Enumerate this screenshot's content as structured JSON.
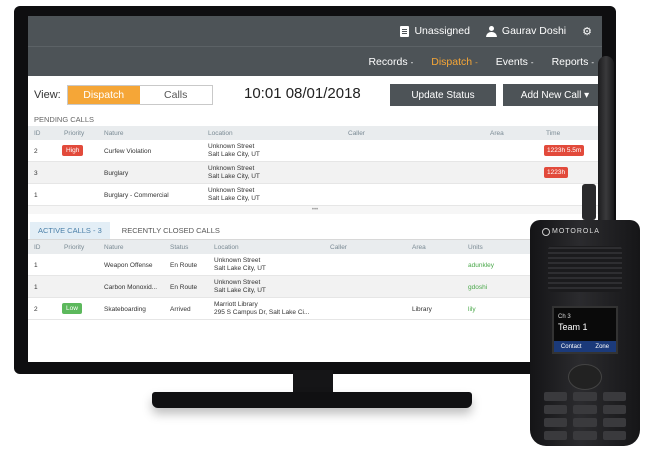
{
  "topbar": {
    "unassigned_label": "Unassigned",
    "user_name": "Gaurav Doshi"
  },
  "nav": [
    {
      "label": "Records",
      "active": false
    },
    {
      "label": "Dispatch",
      "active": true
    },
    {
      "label": "Events",
      "active": false
    },
    {
      "label": "Reports",
      "active": false
    }
  ],
  "controls": {
    "view_label": "View:",
    "toggle_dispatch": "Dispatch",
    "toggle_calls": "Calls",
    "datetime": "10:01 08/01/2018",
    "update_status": "Update Status",
    "add_new_call": "Add New Call"
  },
  "pending": {
    "label": "PENDING CALLS",
    "headers": {
      "id": "ID",
      "priority": "Priority",
      "nature": "Nature",
      "location": "Location",
      "caller": "Caller",
      "area": "Area",
      "time": "Time"
    },
    "rows": [
      {
        "id": "2",
        "priority": "High",
        "nature": "Curfew Violation",
        "loc1": "Unknown Street",
        "loc2": "Salt Lake City, UT",
        "time": "1223h 5.5m"
      },
      {
        "id": "3",
        "priority": "",
        "nature": "Burglary",
        "loc1": "Unknown Street",
        "loc2": "Salt Lake City, UT",
        "time": "1223h"
      },
      {
        "id": "1",
        "priority": "",
        "nature": "Burglary - Commercial",
        "loc1": "Unknown Street",
        "loc2": "Salt Lake City, UT",
        "time": ""
      }
    ]
  },
  "tabs": {
    "active_calls": "ACTIVE CALLS - 3",
    "recently_closed": "RECENTLY CLOSED CALLS"
  },
  "active": {
    "headers": {
      "id": "ID",
      "priority": "Priority",
      "nature": "Nature",
      "status": "Status",
      "location": "Location",
      "caller": "Caller",
      "area": "Area",
      "units": "Units"
    },
    "rows": [
      {
        "id": "1",
        "priority": "",
        "nature": "Weapon Offense",
        "status": "En Route",
        "loc1": "Unknown Street",
        "loc2": "Salt Lake City, UT",
        "area": "",
        "units": "adunkley"
      },
      {
        "id": "1",
        "priority": "",
        "nature": "Carbon Monoxid...",
        "status": "En Route",
        "loc1": "Unknown Street",
        "loc2": "Salt Lake City, UT",
        "area": "",
        "units": "gdoshi"
      },
      {
        "id": "2",
        "priority": "Low",
        "nature": "Skateboarding",
        "status": "Arrived",
        "loc1": "Marriott Library",
        "loc2": "295 S Campus Dr, Salt Lake Ci...",
        "area": "Library",
        "units": "lily"
      }
    ]
  },
  "radio": {
    "brand": "MOTOROLA",
    "channel": "Ch 3",
    "team": "Team 1",
    "softkey_left": "Contact",
    "softkey_right": "Zone"
  },
  "colors": {
    "accent": "#f5a637",
    "header_bar": "#4d5357",
    "high": "#e24a3b",
    "low": "#5cb85c"
  }
}
